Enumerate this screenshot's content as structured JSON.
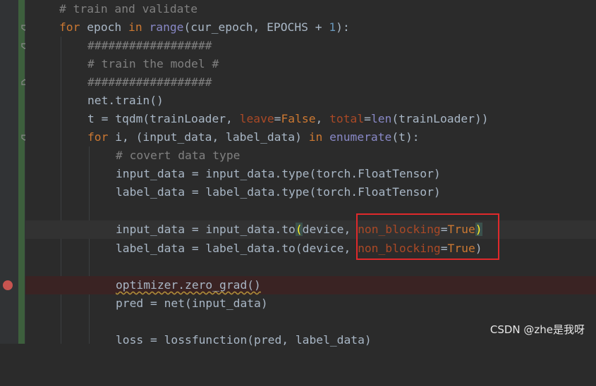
{
  "editor": {
    "lines": {
      "l1": "# train and validate",
      "l2_for": "for",
      "l2_epoch": " epoch ",
      "l2_in": "in",
      "l2_range": "range",
      "l2_rest": "(cur_epoch, EPOCHS + ",
      "l2_num": "1",
      "l2_end": "):",
      "l3": "##################",
      "l4": "# train the model #",
      "l5": "##################",
      "l6": "net.train()",
      "l7_a": "t = tqdm(trainLoader, ",
      "l7_leave": "leave",
      "l7_eq1": "=",
      "l7_false": "False",
      "l7_c": ", ",
      "l7_total": "total",
      "l7_eq2": "=",
      "l7_len": "len",
      "l7_end": "(trainLoader))",
      "l8_for": "for",
      "l8_mid": " i, (input_data, label_data) ",
      "l8_in": "in",
      "l8_sp": " ",
      "l8_enum": "enumerate",
      "l8_end": "(t):",
      "l9": "# covert data type",
      "l10": "input_data = input_data.type(torch.FloatTensor)",
      "l11": "label_data = label_data.type(torch.FloatTensor)",
      "l13_a": "input_data = input_data.to",
      "l13_paren": "(",
      "l13_b": "device, ",
      "l13_nb": "non_blocking",
      "l13_eq": "=",
      "l13_true": "True",
      "l13_close": ")",
      "l14_a": "label_data = label_data.to(device, ",
      "l14_nb": "non_blocking",
      "l14_eq": "=",
      "l14_true": "True",
      "l14_close": ")",
      "l16": "optimizer.zero_grad()",
      "l17": "pred = net(input_data)",
      "l19": "loss = lossfunction(pred, label_data)"
    }
  },
  "watermark": "CSDN @zhe是我呀",
  "colors": {
    "background": "#2b2b2b",
    "keyword": "#cc7832",
    "comment": "#808080",
    "number": "#6897bb",
    "builtin": "#8888c6",
    "param": "#aa4926",
    "highlight_box": "#e0292b",
    "breakpoint": "#c75450"
  }
}
